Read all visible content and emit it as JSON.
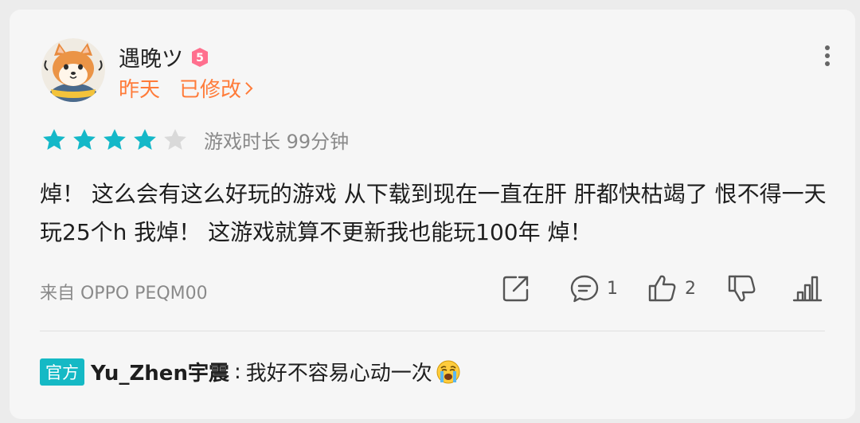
{
  "user": {
    "name": "遇晚ツ",
    "level": "5"
  },
  "meta": {
    "date": "昨天",
    "edited_label": "已修改"
  },
  "rating": {
    "stars": 4,
    "max": 5,
    "playtime": "游戏时长 99分钟"
  },
  "review": {
    "text": "焯！ 这么会有这么好玩的游戏 从下载到现在一直在肝 肝都快枯竭了 恨不得一天玩25个h 我焯！ 这游戏就算不更新我也能玩100年 焯！"
  },
  "device": "来自 OPPO PEQM00",
  "actions": {
    "comment_count": "1",
    "like_count": "2"
  },
  "reply": {
    "badge": "官方",
    "author": "Yu_Zhen宇震",
    "separator": ":",
    "text": "我好不容易心动一次"
  },
  "colors": {
    "accent_orange": "#ff7b39",
    "star_teal": "#14b8c8",
    "star_empty": "#d9d9d9",
    "official_badge": "#15b9c5",
    "level_badge": "#ff6f8e"
  },
  "icons": {
    "avatar": "shiba-dog-avatar",
    "level": "level-5-badge",
    "more": "more-vertical-icon",
    "share": "share-icon",
    "comment": "comment-icon",
    "like": "thumbs-up-icon",
    "dislike": "thumbs-down-icon",
    "stats": "bar-chart-icon",
    "emoji": "crying-face-emoji"
  }
}
